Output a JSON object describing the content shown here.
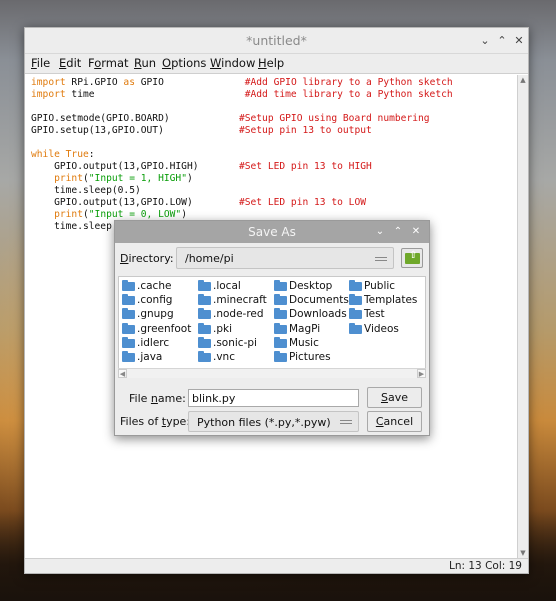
{
  "window": {
    "title": "*untitled*"
  },
  "menu": [
    {
      "u": "F",
      "rest": "ile"
    },
    {
      "u": "E",
      "rest": "dit"
    },
    {
      "pre": "F",
      "u": "o",
      "rest": "rmat"
    },
    {
      "u": "R",
      "rest": "un"
    },
    {
      "u": "O",
      "rest": "ptions"
    },
    {
      "u": "W",
      "rest": "indow"
    },
    {
      "u": "H",
      "rest": "elp"
    }
  ],
  "code_lines": [
    [
      {
        "c": "kw",
        "t": "import"
      },
      {
        "c": "tx",
        "t": " RPi.GPIO "
      },
      {
        "c": "kw",
        "t": "as"
      },
      {
        "c": "tx",
        "t": " GPIO              "
      },
      {
        "c": "cm",
        "t": "#Add GPIO library to a Python sketch"
      }
    ],
    [
      {
        "c": "kw",
        "t": "import"
      },
      {
        "c": "tx",
        "t": " time                          "
      },
      {
        "c": "cm",
        "t": "#Add time library to a Python sketch"
      }
    ],
    [],
    [
      {
        "c": "tx",
        "t": "GPIO.setmode(GPIO.BOARD)            "
      },
      {
        "c": "cm",
        "t": "#Setup GPIO using Board numbering"
      }
    ],
    [
      {
        "c": "tx",
        "t": "GPIO.setup(13,GPIO.OUT)             "
      },
      {
        "c": "cm",
        "t": "#Setup pin 13 to output"
      }
    ],
    [],
    [
      {
        "c": "kw",
        "t": "while True"
      },
      {
        "c": "tx",
        "t": ":"
      }
    ],
    [
      {
        "c": "tx",
        "t": "    GPIO.output(13,GPIO.HIGH)       "
      },
      {
        "c": "cm",
        "t": "#Set LED pin 13 to HIGH"
      }
    ],
    [
      {
        "c": "tx",
        "t": "    "
      },
      {
        "c": "kw",
        "t": "print"
      },
      {
        "c": "tx",
        "t": "("
      },
      {
        "c": "str",
        "t": "\"Input = 1, HIGH\""
      },
      {
        "c": "tx",
        "t": ")"
      }
    ],
    [
      {
        "c": "tx",
        "t": "    time.sleep(0.5)"
      }
    ],
    [
      {
        "c": "tx",
        "t": "    GPIO.output(13,GPIO.LOW)        "
      },
      {
        "c": "cm",
        "t": "#Set LED pin 13 to LOW"
      }
    ],
    [
      {
        "c": "tx",
        "t": "    "
      },
      {
        "c": "kw",
        "t": "print"
      },
      {
        "c": "tx",
        "t": "("
      },
      {
        "c": "str",
        "t": "\"Input = 0, LOW\""
      },
      {
        "c": "tx",
        "t": ")"
      }
    ],
    [
      {
        "c": "tx",
        "t": "    time.sleep"
      }
    ]
  ],
  "status": {
    "text": "Ln: 13  Col: 19"
  },
  "dialog": {
    "title": "Save As",
    "directory_label_u": "D",
    "directory_label_rest": "irectory:",
    "directory_value": "/home/pi",
    "files_col1": [
      ".cache",
      ".config",
      ".gnupg",
      ".greenfoot",
      ".idlerc",
      ".java"
    ],
    "files_col2": [
      ".local",
      ".minecraft",
      ".node-red",
      ".pki",
      ".sonic-pi",
      ".vnc"
    ],
    "files_col3": [
      "Desktop",
      "Documents",
      "Downloads",
      "MagPi",
      "Music",
      "Pictures"
    ],
    "files_col4": [
      "Public",
      "Templates",
      "Test",
      "Videos"
    ],
    "filename_label_pre": "File ",
    "filename_label_u": "n",
    "filename_label_rest": "ame:",
    "filename_value": "blink.py",
    "filetype_label_pre": "Files of ",
    "filetype_label_u": "t",
    "filetype_label_rest": "ype:",
    "filetype_value": "Python files (*.py,*.pyw)",
    "save_u": "S",
    "save_rest": "ave",
    "cancel_u": "C",
    "cancel_rest": "ancel"
  }
}
